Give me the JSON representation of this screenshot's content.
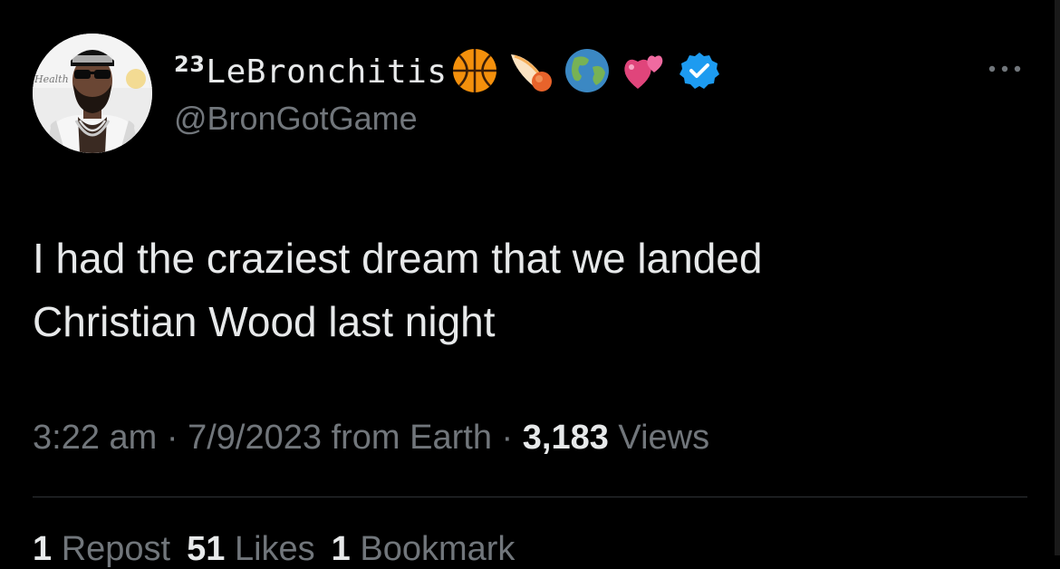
{
  "user": {
    "display_name_number": "23",
    "display_name": "LeBronchitis",
    "handle": "@BronGotGame",
    "emojis": [
      "basketball-icon",
      "comet-icon",
      "globe-icon",
      "two-hearts-icon"
    ],
    "verified_icon": "verified-badge-icon",
    "avatar_text": "Health"
  },
  "tweet": {
    "line1": "I had the craziest dream that we landed",
    "line2": "Christian Wood last night"
  },
  "meta": {
    "time": "3:22 am",
    "sep1": "·",
    "date": "7/9/2023",
    "source": "from Earth",
    "sep2": "·",
    "views_count": "3,183",
    "views_label": "Views"
  },
  "stats": {
    "reposts_count": "1",
    "reposts_label": "Repost",
    "likes_count": "51",
    "likes_label": "Likes",
    "bookmarks_count": "1",
    "bookmarks_label": "Bookmark"
  },
  "colors": {
    "background": "#000000",
    "text_primary": "#e7e9ea",
    "text_secondary": "#71767b",
    "verified_blue": "#1d9bf0",
    "divider": "#2f3336"
  }
}
